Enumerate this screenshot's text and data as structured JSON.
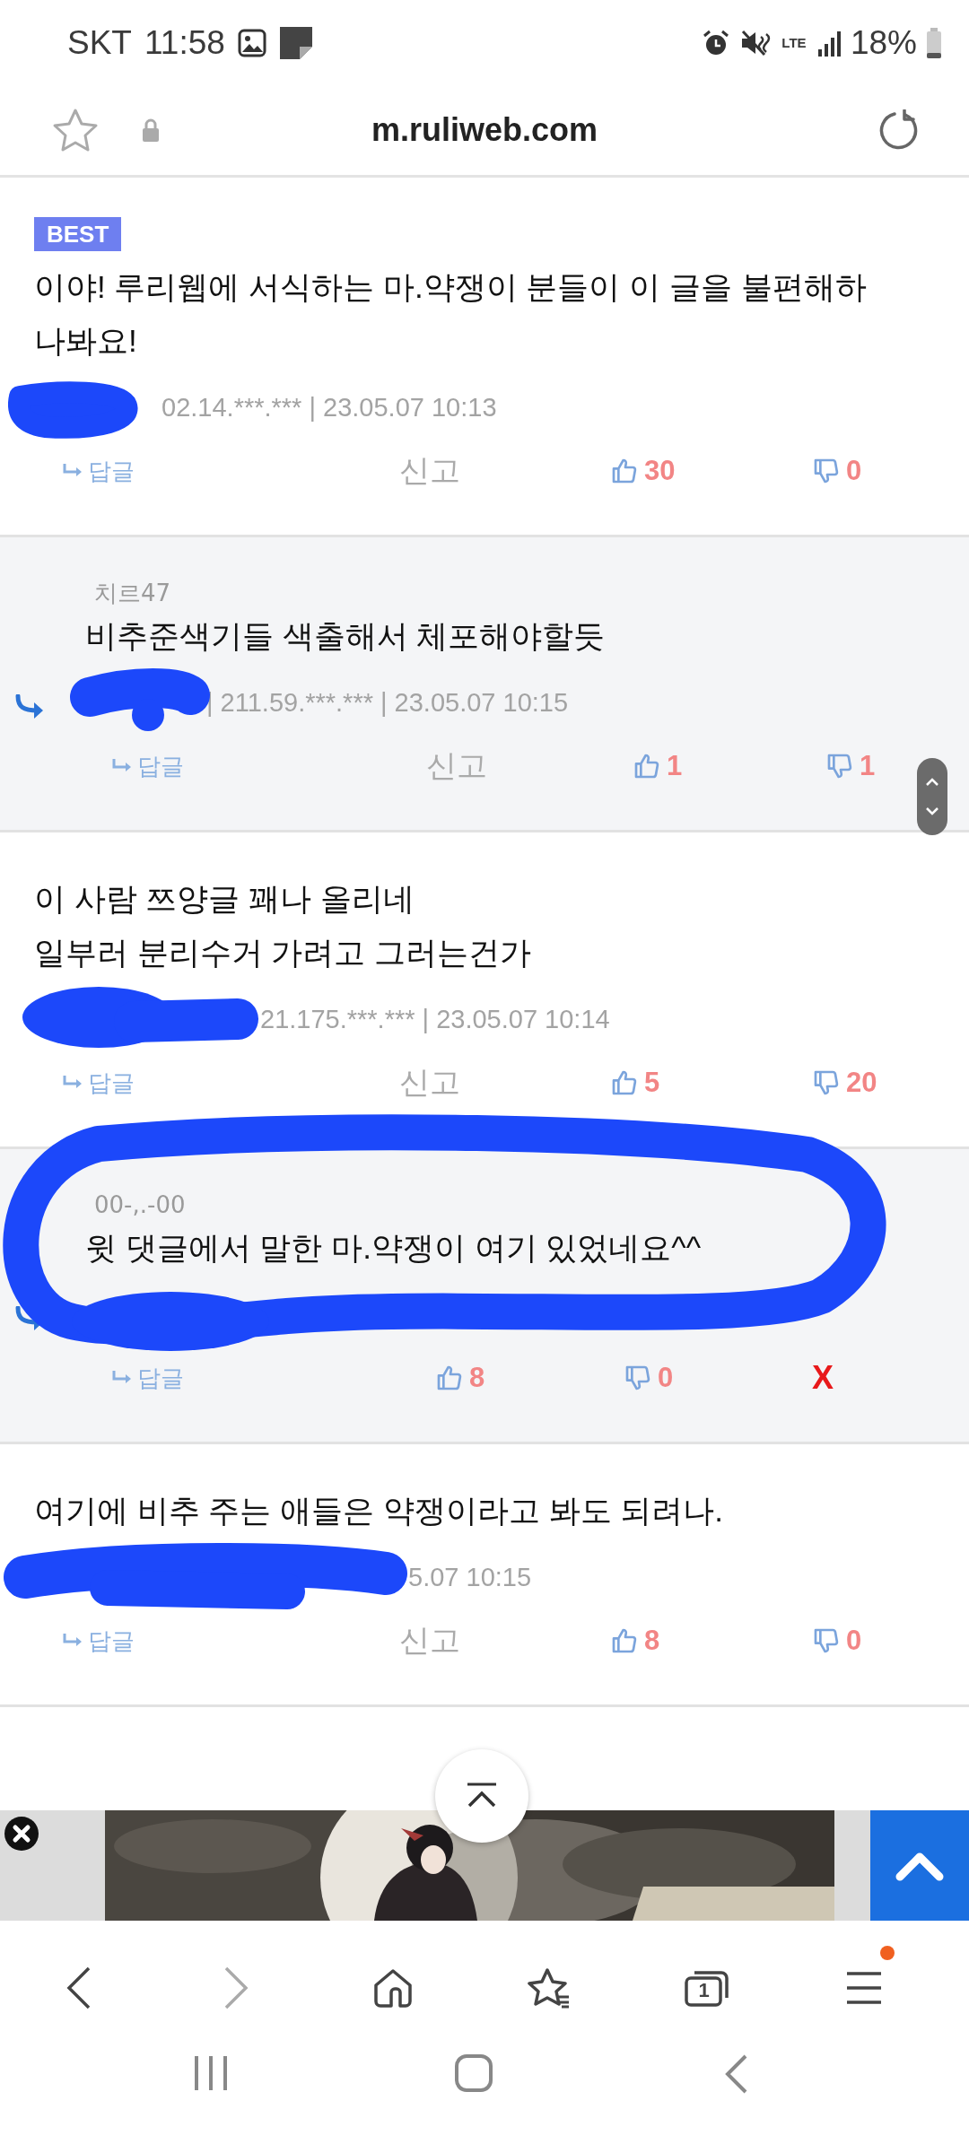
{
  "status_bar": {
    "carrier": "SKT",
    "time": "11:58",
    "network": "LTE",
    "battery": "18%"
  },
  "address_bar": {
    "url": "m.ruliweb.com"
  },
  "comments": [
    {
      "kind": "comment",
      "best": true,
      "best_label": "BEST",
      "text": "이야! 루리웹에 서식하는 마.약쟁이 분들이 이 글을 불편해하나봐요!",
      "meta": "02.14.***.*** | 23.05.07 10:13",
      "actions": [
        {
          "kind": "reply",
          "label": "답글"
        },
        {
          "kind": "report",
          "label": "신고"
        },
        {
          "kind": "like",
          "label": "30"
        },
        {
          "kind": "dislike",
          "label": "0"
        }
      ]
    },
    {
      "kind": "reply",
      "best": false,
      "nickname": "치르47",
      "text": "비추준색기들 색출해서 체포해야할듯",
      "meta": "| 211.59.***.*** | 23.05.07 10:15",
      "actions": [
        {
          "kind": "reply",
          "label": "답글"
        },
        {
          "kind": "report",
          "label": "신고"
        },
        {
          "kind": "like",
          "label": "1"
        },
        {
          "kind": "dislike",
          "label": "1"
        }
      ]
    },
    {
      "kind": "comment",
      "best": false,
      "text": "이 사람 쯔양글 꽤나 올리네\n일부러 분리수거 가려고 그러는건가",
      "meta": "21.175.***.*** | 23.05.07 10:14",
      "actions": [
        {
          "kind": "reply",
          "label": "답글"
        },
        {
          "kind": "report",
          "label": "신고"
        },
        {
          "kind": "like",
          "label": "5"
        },
        {
          "kind": "dislike",
          "label": "20"
        }
      ]
    },
    {
      "kind": "reply",
      "best": false,
      "nickname": "00-,.-00",
      "text": "윗 댓글에서 말한 마.약쟁이 여기 있었네요^^",
      "actions": [
        {
          "kind": "reply",
          "label": "답글"
        },
        {
          "kind": "like",
          "label": "8"
        },
        {
          "kind": "dislike",
          "label": "0"
        },
        {
          "kind": "delete",
          "label": "X"
        }
      ]
    },
    {
      "kind": "comment",
      "best": false,
      "text": "여기에 비추 주는 애들은 약쟁이라고 봐도 되려나.",
      "meta": "5.07 10:15",
      "actions": [
        {
          "kind": "reply",
          "label": "답글"
        },
        {
          "kind": "report",
          "label": "신고"
        },
        {
          "kind": "like",
          "label": "8"
        },
        {
          "kind": "dislike",
          "label": "0"
        }
      ]
    }
  ],
  "bottom_nav": [
    {
      "kind": "back",
      "disabled": false
    },
    {
      "kind": "forward",
      "disabled": true
    },
    {
      "kind": "home",
      "disabled": false
    },
    {
      "kind": "bookmarks",
      "disabled": false
    },
    {
      "kind": "tabs",
      "disabled": false,
      "count": "1"
    },
    {
      "kind": "menu",
      "disabled": false,
      "badge": true
    }
  ]
}
